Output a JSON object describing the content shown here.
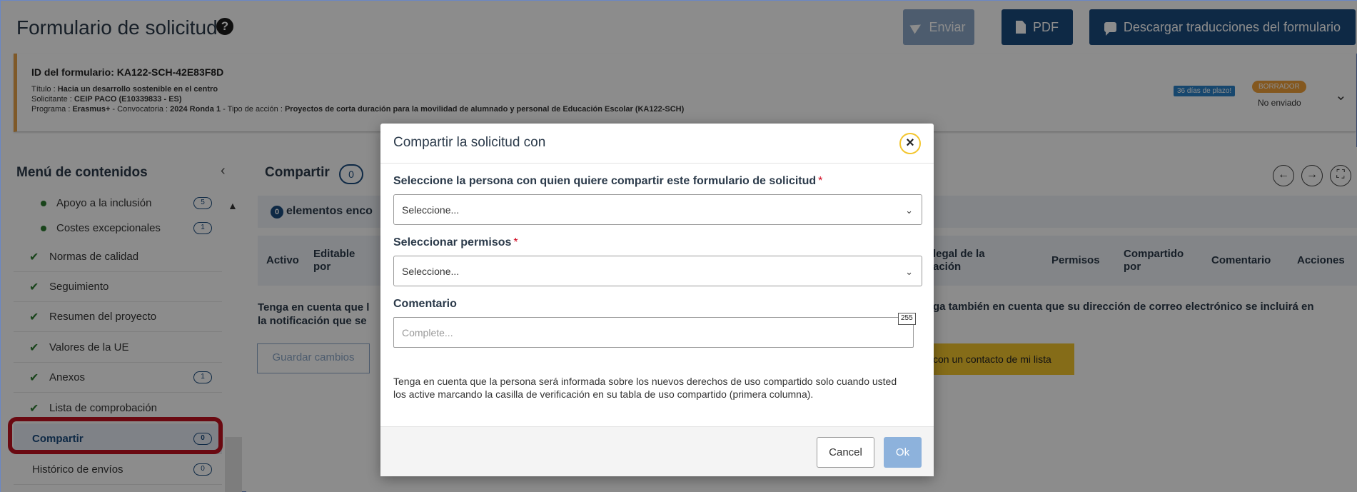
{
  "header": {
    "title": "Formulario de solicitud",
    "buttons": {
      "enviar": "Enviar",
      "pdf": "PDF",
      "translations": "Descargar traducciones del formulario"
    }
  },
  "form_info": {
    "id_line": "ID del formulario: KA122-SCH-42E83F8D",
    "title_label": "Título : ",
    "title_value": "Hacia un desarrollo sostenible en el centro",
    "applicant_label": "Solicitante : ",
    "applicant_value": "CEIP PACO (E10339833 - ES)",
    "program_label": "Programa : ",
    "program_value": "Erasmus+",
    "call_label": " - Convocatoria : ",
    "call_value": "2024 Ronda 1",
    "action_label": " - Tipo de acción : ",
    "action_value": "Proyectos de corta duración para la movilidad de alumnado y personal de Educación Escolar (KA122-SCH)",
    "days_badge": "36 días de plazo!",
    "draft_badge": "BORRADOR",
    "status": "No enviado"
  },
  "sidebar": {
    "title": "Menú de contenidos",
    "items": [
      {
        "label": "Apoyo a la inclusión",
        "count": "5",
        "kind": "sub"
      },
      {
        "label": "Costes excepcionales",
        "count": "1",
        "kind": "sub"
      },
      {
        "label": "Normas de calidad",
        "count": "",
        "kind": "check"
      },
      {
        "label": "Seguimiento",
        "count": "",
        "kind": "check"
      },
      {
        "label": "Resumen del proyecto",
        "count": "",
        "kind": "check"
      },
      {
        "label": "Valores de la UE",
        "count": "",
        "kind": "check"
      },
      {
        "label": "Anexos",
        "count": "1",
        "kind": "check"
      },
      {
        "label": "Lista de comprobación",
        "count": "",
        "kind": "check"
      },
      {
        "label": "Compartir",
        "count": "0",
        "kind": "active"
      },
      {
        "label": "Histórico de envíos",
        "count": "0",
        "kind": "plain"
      }
    ]
  },
  "main": {
    "title": "Compartir",
    "count": "0",
    "found_count": "0",
    "found_text": "elementos enco",
    "columns": {
      "activo": "Activo",
      "editable": "Editable por",
      "legal": "legal de la ación",
      "permisos": "Permisos",
      "compartido": "Compartido por",
      "comentario": "Comentario",
      "acciones": "Acciones"
    },
    "note_line1": "Tenga en cuenta que l",
    "note_line2": "la notificación que se",
    "note_right": "ga también en cuenta que su dirección de correo electrónico se incluirá en",
    "save_button": "Guardar cambios",
    "contact_button": "con un contacto de mi lista"
  },
  "modal": {
    "title": "Compartir la solicitud con",
    "person_label": "Seleccione la persona con quien quiere compartir este formulario de solicitud",
    "person_value": "Seleccione...",
    "permissions_label": "Seleccionar permisos",
    "permissions_value": "Seleccione...",
    "comment_label": "Comentario",
    "comment_placeholder": "Complete...",
    "char_limit": "255",
    "note": "Tenga en cuenta que la persona será informada sobre los nuevos derechos de uso compartido solo cuando usted los active marcando la casilla de verificación en su tabla de uso compartido (primera columna).",
    "cancel": "Cancel",
    "ok": "Ok"
  },
  "icons": {
    "help": "question-circle-icon",
    "send": "paper-plane-icon",
    "pdf": "file-icon",
    "translations": "comment-icon",
    "close": "close-icon",
    "check": "checkmark-icon"
  },
  "colors": {
    "primary": "#1b4b7e",
    "disabled": "#8da8c8",
    "warning": "#f0a13a",
    "highlight": "#c1121f",
    "accent": "#f3c52d",
    "success": "#2e7d32"
  }
}
